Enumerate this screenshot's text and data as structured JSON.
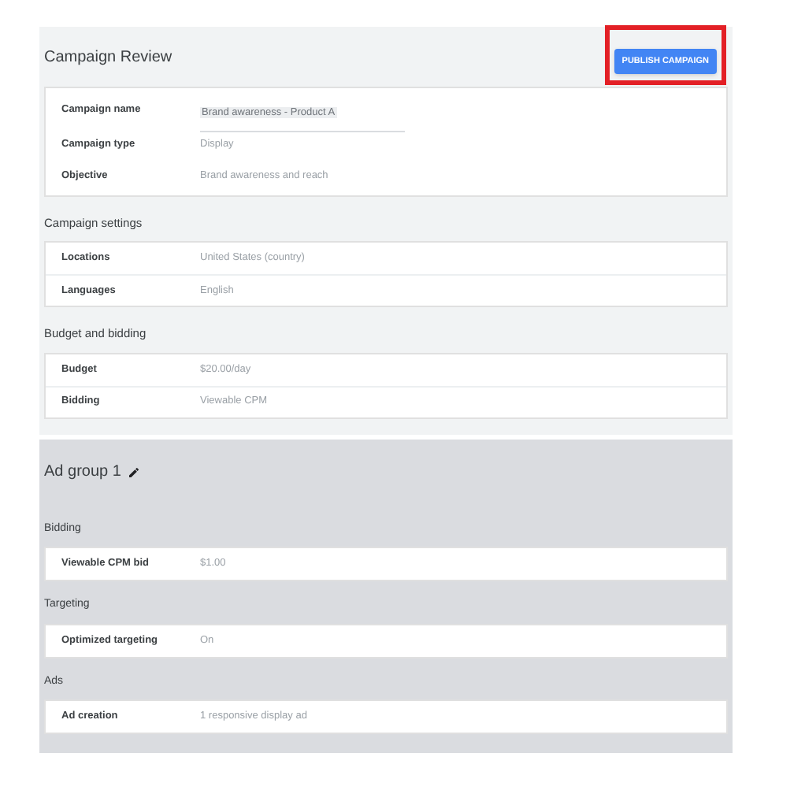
{
  "header": {
    "title": "Campaign Review",
    "publish_button": {
      "label": "PUBLISH CAMPAIGN",
      "highlighted": true
    }
  },
  "summary": [
    {
      "kind": "field",
      "label": "Campaign name",
      "value": "Brand awareness - Product A"
    },
    {
      "kind": "text",
      "label": "Campaign type",
      "value": "Display"
    },
    {
      "kind": "text",
      "label": "Objective",
      "value": "Brand awareness and reach"
    }
  ],
  "sections": [
    {
      "title": "Campaign settings",
      "rows": [
        {
          "label": "Locations",
          "value": "United States (country)"
        },
        {
          "label": "Languages",
          "value": "English"
        }
      ]
    },
    {
      "title": "Budget and bidding",
      "rows": [
        {
          "label": "Budget",
          "value": "$20.00/day"
        },
        {
          "label": "Bidding",
          "value": "Viewable CPM"
        }
      ]
    }
  ],
  "ad_group": {
    "title": "Ad group 1",
    "sections": [
      {
        "title": "Bidding",
        "rows": [
          {
            "label": "Viewable CPM bid",
            "value": "$1.00"
          }
        ]
      },
      {
        "title": "Targeting",
        "rows": [
          {
            "label": "Optimized targeting",
            "value": "On"
          }
        ]
      },
      {
        "title": "Ads",
        "rows": [
          {
            "label": "Ad creation",
            "value": "1 responsive display ad"
          }
        ]
      }
    ]
  }
}
